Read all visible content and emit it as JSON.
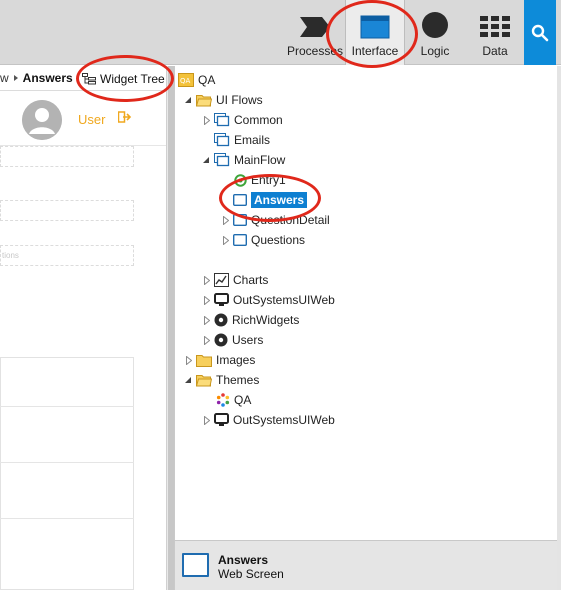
{
  "toolbar": {
    "tabs": [
      {
        "label": "Processes",
        "icon": "processes-icon"
      },
      {
        "label": "Interface",
        "icon": "interface-icon",
        "active": true
      },
      {
        "label": "Logic",
        "icon": "logic-icon"
      },
      {
        "label": "Data",
        "icon": "data-icon"
      }
    ],
    "search_icon": "search-icon",
    "accent": "#0d8bd9"
  },
  "canvas": {
    "breadcrumb_prev": "w",
    "breadcrumb_current": "Answers",
    "widget_tree_label": "Widget Tree",
    "user_label": "User",
    "placeholder_fragment": "tions"
  },
  "tree": {
    "root": "QA",
    "ui_flows": "UI Flows",
    "common": "Common",
    "emails": "Emails",
    "mainflow": "MainFlow",
    "entry1": "Entry1",
    "answers": "Answers",
    "question_detail": "QuestionDetail",
    "questions": "Questions",
    "charts": "Charts",
    "outsystemsuiweb": "OutSystemsUIWeb",
    "richwidgets": "RichWidgets",
    "users": "Users",
    "images": "Images",
    "themes": "Themes",
    "theme_qa": "QA",
    "theme_outsystemsuiweb": "OutSystemsUIWeb"
  },
  "status": {
    "title": "Answers",
    "subtitle": "Web Screen"
  },
  "colors": {
    "selection": "#0d7fd1",
    "annotation": "#e0281b",
    "user_link": "#f0a81e",
    "folder": "#f5c342"
  }
}
